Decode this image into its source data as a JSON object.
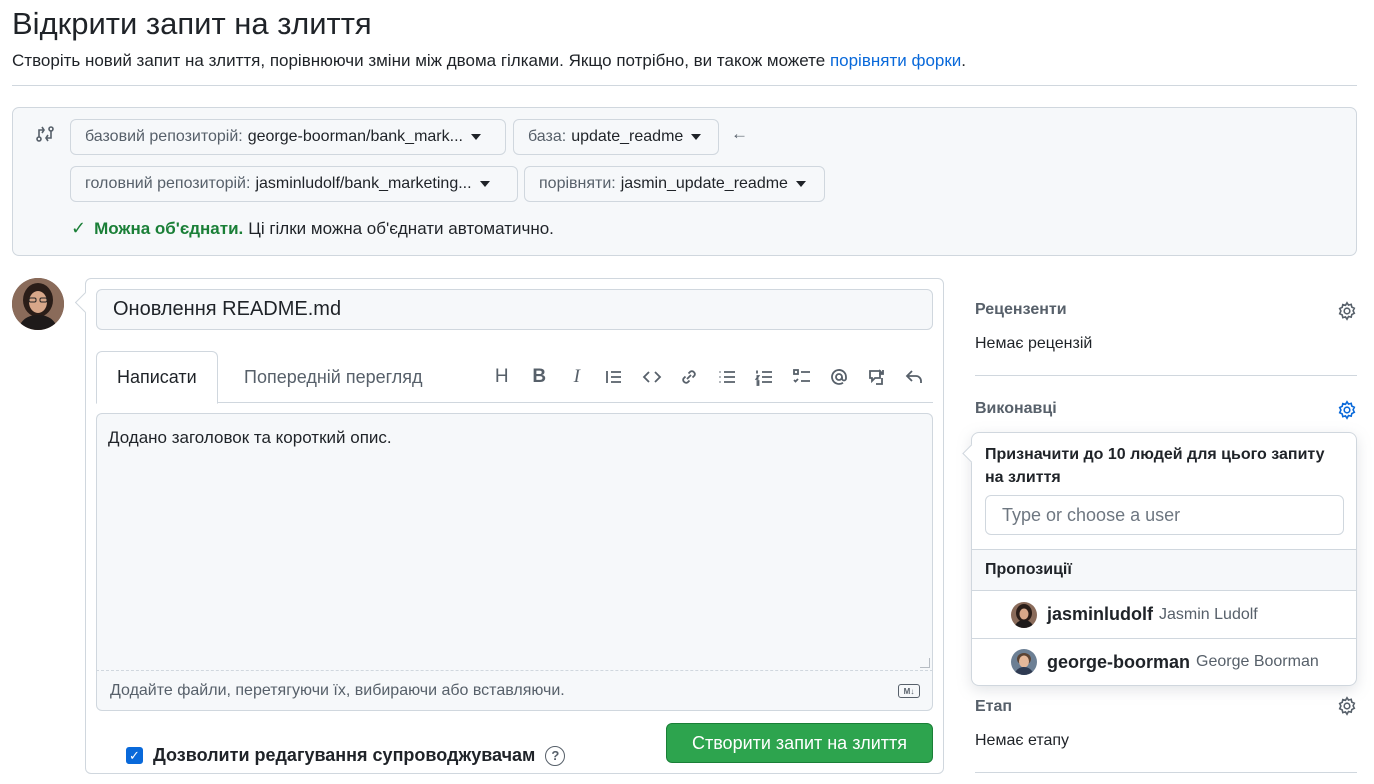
{
  "header": {
    "title": "Відкрити запит на злиття",
    "subtitle": "Створіть новий запит на злиття, порівнюючи зміни між двома гілками. Якщо потрібно, ви також можете",
    "subtitle_link": "порівняти форки",
    "subtitle_end": "."
  },
  "compare": {
    "base_repo_label": "базовий репозиторій:",
    "base_repo_value": "george-boorman/bank_mark...",
    "base_label": "база:",
    "base_value": "update_readme",
    "head_repo_label": "головний репозиторій:",
    "head_repo_value": "jasminludolf/bank_marketing...",
    "compare_label": "порівняти:",
    "compare_value": "jasmin_update_readme",
    "status_ok": "Можна об'єднати.",
    "status_text": "Ці гілки можна об'єднати автоматично."
  },
  "editor": {
    "title_value": "Оновлення README.md",
    "tab_write": "Написати",
    "tab_preview": "Попередній перегляд",
    "toolbar_heading": "H",
    "toolbar_bold": "B",
    "toolbar_italic": "I",
    "body_text": "Додано заголовок та короткий опис.",
    "attach_text": "Додайте файли, перетягуючи їх, вибираючи або вставляючи.",
    "markdown_badge": "M↓",
    "allow_edit_label": "Дозволити редагування супроводжувачам",
    "help_glyph": "?",
    "submit_label": "Створити запит на злиття"
  },
  "sidebar": {
    "reviewers_heading": "Рецензенти",
    "reviewers_value": "Немає рецензій",
    "assignees_heading": "Виконавці",
    "milestone_heading": "Етап",
    "milestone_value": "Немає етапу"
  },
  "assignee_popup": {
    "title": "Призначити до 10 людей для цього запиту на злиття",
    "input_placeholder": "Type or choose a user",
    "suggestions_heading": "Пропозиції",
    "users": [
      {
        "login": "jasminludolf",
        "full_name": "Jasmin Ludolf"
      },
      {
        "login": "george-boorman",
        "full_name": "George Boorman"
      }
    ]
  },
  "colors": {
    "accent": "#0969da",
    "success": "#1a7f37",
    "button_green": "#2da44e",
    "border": "#d0d7de",
    "muted_text": "#57606a"
  }
}
